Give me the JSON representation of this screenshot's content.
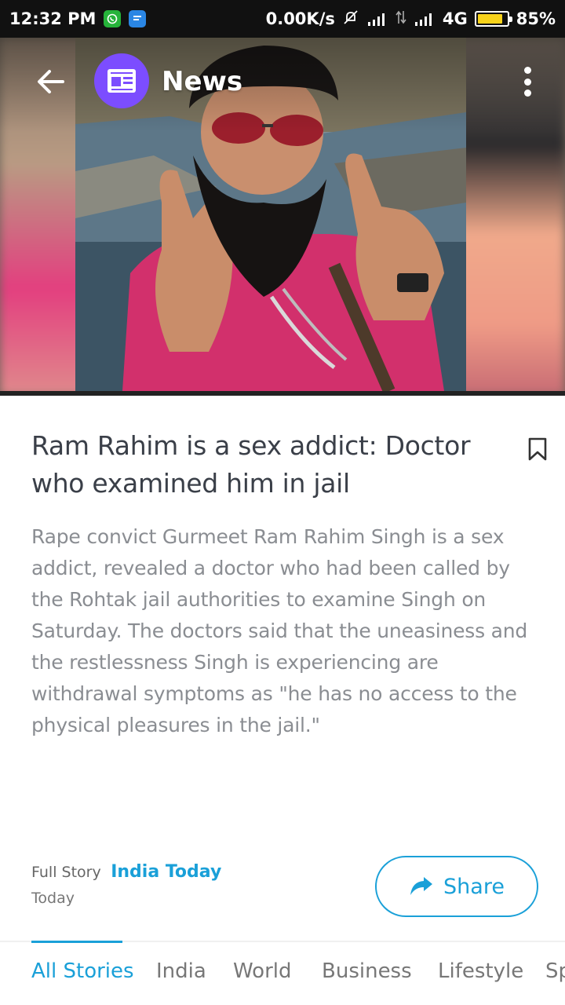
{
  "status_bar": {
    "time": "12:32 PM",
    "network_speed": "0.00K/s",
    "network_type": "4G",
    "battery": "85%",
    "battery_level": 0.85,
    "icons": [
      "whatsapp-icon",
      "messaging-icon",
      "mute-bell-icon",
      "signal-icon",
      "data-arrows-icon",
      "signal-icon",
      "battery-icon"
    ]
  },
  "toolbar": {
    "title": "News",
    "back_icon": "arrow-left-icon",
    "badge_icon": "newspaper-icon",
    "menu_icon": "more-vert-icon",
    "badge_color": "#7c4dff"
  },
  "hero": {
    "image_name": "article-photo"
  },
  "article": {
    "headline": "Ram Rahim is a sex addict: Doctor who examined him in jail",
    "summary": "Rape convict Gurmeet Ram Rahim Singh is a sex addict, revealed a doctor who had been called by the Rohtak jail authorities to examine Singh on Saturday. The doctors said that the uneasiness and the restlessness Singh is experiencing are withdrawal symptoms as \"he has no access to the physical pleasures in the jail.\"",
    "full_story_label": "Full Story",
    "source": "India Today",
    "date": "Today",
    "share_label": "Share",
    "accent_color": "#1aa0d8"
  },
  "tabs": [
    {
      "label": "All Stories",
      "active": true
    },
    {
      "label": "India",
      "active": false
    },
    {
      "label": "World",
      "active": false
    },
    {
      "label": "Business",
      "active": false
    },
    {
      "label": "Lifestyle",
      "active": false
    },
    {
      "label": "Sp",
      "active": false
    }
  ]
}
